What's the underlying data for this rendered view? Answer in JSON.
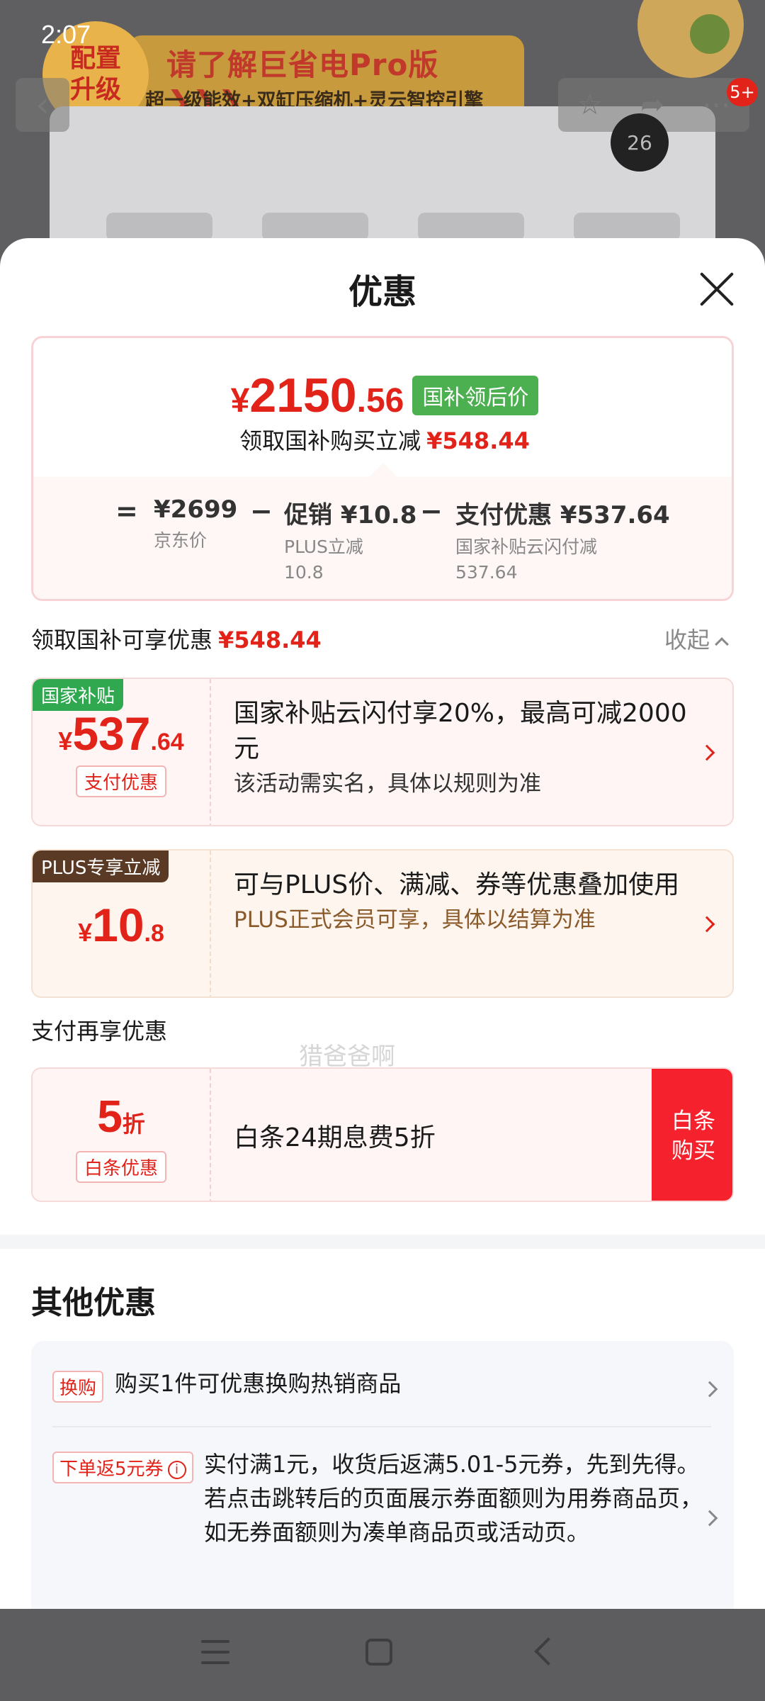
{
  "status_bar": {
    "time": "2:07"
  },
  "background": {
    "badge_line1": "配置",
    "badge_line2": "升级",
    "banner_title": "请了解巨省电Pro版 ❯❯❯",
    "banner_sub": "超一级能效+双缸压缩机+灵云智控引擎",
    "notification_count": "5+",
    "temp_display": "26"
  },
  "sheet": {
    "title": "优惠",
    "price": {
      "symbol": "¥",
      "integer": "2150",
      "decimal": ".56",
      "tag": "国补领后价",
      "saving_label": "领取国补购买立减",
      "saving_amount": "¥548.44"
    },
    "breakdown": {
      "equals": "=",
      "minus": "−",
      "jd_price": "¥2699",
      "jd_label": "京东价",
      "promo_main": "促销 ¥10.8",
      "promo_sub_line1": "PLUS立减",
      "promo_sub_line2": "10.8",
      "pay_main": "支付优惠 ¥537.64",
      "pay_sub_line1": "国家补贴云闪付减",
      "pay_sub_line2": "537.64"
    },
    "section_head": "领取国补可享优惠",
    "section_amount": "¥548.44",
    "collapse_label": "收起",
    "offers": [
      {
        "tag": "国家补贴",
        "symbol": "¥",
        "integer": "537",
        "decimal": ".64",
        "chip": "支付优惠",
        "main": "国家补贴云闪付享20%，最高可减2000元",
        "sub": "该活动需实名，具体以规则为准"
      },
      {
        "tag": "PLUS专享立减",
        "symbol": "¥",
        "integer": "10",
        "decimal": ".8",
        "main": "可与PLUS价、满减、券等优惠叠加使用",
        "sub": "PLUS正式会员可享，具体以结算为准"
      }
    ],
    "pay_section_head": "支付再享优惠",
    "baitiao": {
      "discount_num": "5",
      "discount_unit": "折",
      "chip": "白条优惠",
      "text": "白条24期息费5折",
      "buy_line1": "白条",
      "buy_line2": "购买"
    },
    "other_title": "其他优惠",
    "other_items": [
      {
        "tag": "换购",
        "text": "购买1件可优惠换购热销商品"
      },
      {
        "tag": "下单返5元券",
        "text": "实付满1元，收货后返满5.01-5元券，先到先得。若点击跳转后的页面展示券面额则为用券商品页，如无券面额则为凑单商品页或活动页。"
      }
    ],
    "watermark": "猎爸爸啊"
  },
  "colors": {
    "accent_red": "#e2231a",
    "green_tag": "#4caf50",
    "plus_tag": "#5a3a24",
    "buy_button": "#f5222d"
  },
  "icons": [
    "back-icon",
    "star-icon",
    "share-icon",
    "more-icon",
    "close-icon",
    "chevron-up-icon",
    "chevron-right-icon",
    "info-icon",
    "menu-icon",
    "home-icon",
    "nav-back-icon"
  ]
}
